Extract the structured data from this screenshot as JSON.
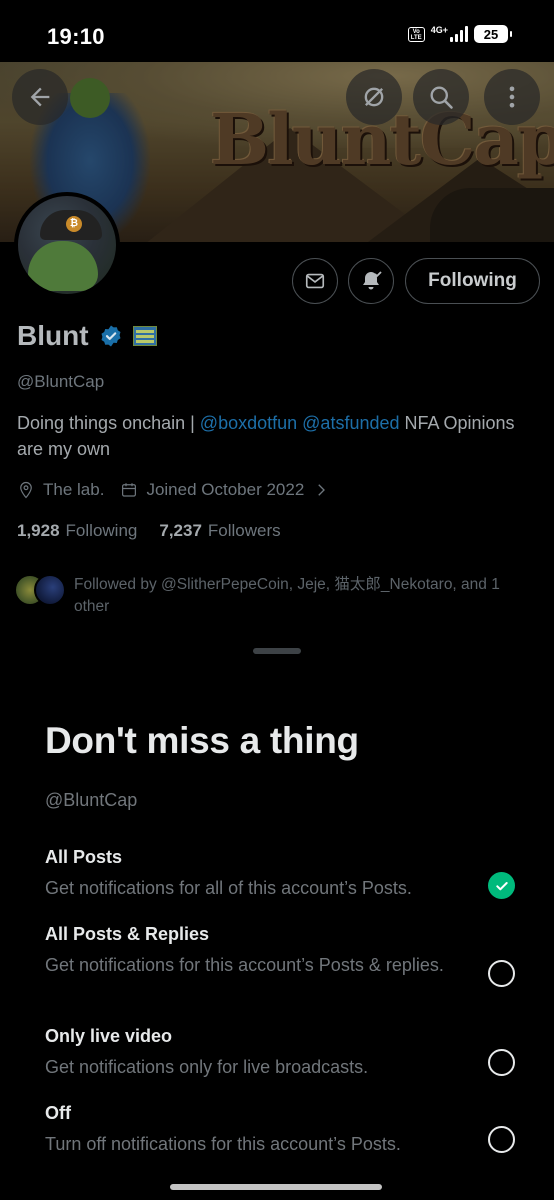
{
  "status_bar": {
    "time": "19:10",
    "volte_label": "Vo LTE",
    "network_label": "4G+",
    "battery_level": "25",
    "icons": [
      "volte-icon",
      "signal-icon",
      "battery-icon"
    ]
  },
  "banner": {
    "title_text": "BluntCap",
    "buttons": [
      "back-arrow-icon",
      "grok-icon",
      "search-icon",
      "more-vertical-icon"
    ]
  },
  "profile": {
    "actions": {
      "message_icon": "envelope-icon",
      "notify_icon": "bell-check-icon",
      "following_label": "Following"
    },
    "name": "Blunt",
    "handle": "@BluntCap",
    "bio_text_1": "Doing things onchain | ",
    "bio_link_1": "@boxdotfun",
    "bio_space": " ",
    "bio_link_2": "@atsfunded",
    "bio_text_2": " NFA Opinions are my own",
    "location": "The lab.",
    "joined": "Joined October 2022",
    "following_count": "1,928",
    "following_label": "Following",
    "followers_count": "7,237",
    "followers_label": "Followers",
    "followed_by": "Followed by @SlitherPepeCoin, Jeje, 猫太郎_Nekotaro, and 1 other"
  },
  "sheet": {
    "title": "Don't miss a thing",
    "handle": "@BluntCap",
    "options": [
      {
        "title": "All Posts",
        "desc": "Get notifications for all of this account’s Posts.",
        "selected": true
      },
      {
        "title": "All Posts & Replies",
        "desc": "Get notifications for this account’s Posts & replies.",
        "selected": false
      },
      {
        "title": "Only live video",
        "desc": "Get notifications only for live broadcasts.",
        "selected": false
      },
      {
        "title": "Off",
        "desc": "Turn off notifications for this account’s Posts.",
        "selected": false
      }
    ]
  },
  "colors": {
    "accent_link": "#1d9bf0",
    "verified": "#1d9bf0",
    "selected_green": "#00ba7c"
  }
}
